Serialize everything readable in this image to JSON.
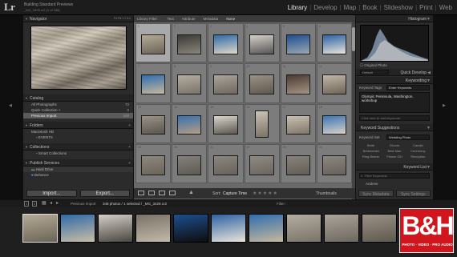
{
  "app": {
    "logo": "Lr",
    "catalog_title": "Building Standard Previews",
    "catalog_sub": "_MG_3405.cr2 (1 of 348)"
  },
  "modules": [
    "Library",
    "Develop",
    "Map",
    "Book",
    "Slideshow",
    "Print",
    "Web"
  ],
  "active_module": "Library",
  "left_panel": {
    "navigator": {
      "label": "Navigator",
      "zoom": "Fit  Fill  1:1  3:1"
    },
    "catalog": {
      "label": "Catalog",
      "items": [
        {
          "label": "All Photographs",
          "count": "70"
        },
        {
          "label": "Quick Collection +",
          "count": "0"
        },
        {
          "label": "Previous Import",
          "count": "348"
        }
      ]
    },
    "folders": {
      "label": "Folders",
      "items": [
        {
          "label": "Macintosh HD",
          "count": ""
        },
        {
          "label": "EVENTS",
          "count": ""
        }
      ]
    },
    "collections": {
      "label": "Collections",
      "items": [
        {
          "label": "Smart Collections"
        }
      ]
    },
    "publish": {
      "label": "Publish Services",
      "items": [
        {
          "label": "Hard Drive"
        },
        {
          "label": "Behance"
        }
      ]
    },
    "import_label": "Import...",
    "export_label": "Export..."
  },
  "grid": {
    "filter_bar": [
      "Library Filter :",
      "Text",
      "Attribute",
      "Metadata",
      "None"
    ],
    "cells": [
      {
        "num": "1",
        "c1": "#b5aa96",
        "c2": "#6b6457",
        "v": false,
        "sel": true
      },
      {
        "num": "2",
        "c1": "#3c3a37",
        "c2": "#8a867c",
        "v": false,
        "sel": false
      },
      {
        "num": "3",
        "c1": "#2f6aa8",
        "c2": "#e0d8c6",
        "v": false,
        "sel": false
      },
      {
        "num": "4",
        "c1": "#d4d0c8",
        "c2": "#555",
        "v": false,
        "sel": false
      },
      {
        "num": "5",
        "c1": "#1d4f8e",
        "c2": "#9aa8b4",
        "v": false,
        "sel": false
      },
      {
        "num": "6",
        "c1": "#2d62a3",
        "c2": "#e8e4da",
        "v": false,
        "sel": false
      },
      {
        "num": "7",
        "c1": "#2f6dae",
        "c2": "#c6b89e",
        "v": false,
        "sel": false
      },
      {
        "num": "8",
        "c1": "#b4aea2",
        "c2": "#7a7468",
        "v": false,
        "sel": false
      },
      {
        "num": "9",
        "c1": "#aaa49a",
        "c2": "#6d675d",
        "v": false,
        "sel": false
      },
      {
        "num": "10",
        "c1": "#9b9286",
        "c2": "#5e584e",
        "v": false,
        "sel": false
      },
      {
        "num": "11",
        "c1": "#4b3a32",
        "c2": "#a39684",
        "v": false,
        "sel": false
      },
      {
        "num": "12",
        "c1": "#c0b7a8",
        "c2": "#6e6558",
        "v": false,
        "sel": false
      },
      {
        "num": "13",
        "c1": "#9a9388",
        "c2": "#5a544a",
        "v": false,
        "sel": false
      },
      {
        "num": "14",
        "c1": "#3870b0",
        "c2": "#b59d83",
        "v": false,
        "sel": false
      },
      {
        "num": "15",
        "c1": "#d9d5cc",
        "c2": "#5b574f",
        "v": false,
        "sel": false
      },
      {
        "num": "16",
        "c1": "#cbc3b4",
        "c2": "#7b7266",
        "v": true,
        "sel": false
      },
      {
        "num": "17",
        "c1": "#c8c0b2",
        "c2": "#807768",
        "v": false,
        "sel": false
      },
      {
        "num": "18",
        "c1": "#3b75b6",
        "c2": "#d8d2c6",
        "v": false,
        "sel": false
      },
      {
        "num": "19",
        "c1": "#8d877c",
        "c2": "#6a645a",
        "v": false,
        "sel": false
      },
      {
        "num": "20",
        "c1": "#85807a",
        "c2": "#5d5953",
        "v": false,
        "sel": false
      },
      {
        "num": "21",
        "c1": "#8a857d",
        "c2": "#67635c",
        "v": false,
        "sel": false
      },
      {
        "num": "22",
        "c1": "#8f8a82",
        "c2": "#6a665f",
        "v": false,
        "sel": false
      },
      {
        "num": "23",
        "c1": "#87827a",
        "c2": "#625e57",
        "v": false,
        "sel": false
      },
      {
        "num": "24",
        "c1": "#8b867e",
        "c2": "#66625b",
        "v": false,
        "sel": false
      }
    ]
  },
  "toolbar": {
    "sort_label": "Sort:",
    "sort_value": "Capture Time",
    "thumbs_label": "Thumbnails"
  },
  "right_panel": {
    "histogram_label": "Histogram",
    "original_photo": "Original Photo",
    "quick_develop": "Quick Develop",
    "saved_preset": "Default",
    "keywording": "Keywording",
    "keyword_tags_label": "Keyword Tags",
    "keyword_tags_value": "Enter Keywords",
    "keywords_text": "Olympic Peninsula, Washington, workshop",
    "click_add": "Click here to add keywords",
    "keyword_suggestions": "Keyword Suggestions",
    "keyword_set_label": "Keyword Set",
    "keyword_set_value": "Wedding Photo",
    "keyword_set_items": [
      "Bride",
      "Groom",
      "Candid",
      "Bridesmaid",
      "Best Man",
      "Ceremony",
      "Ring Bearer",
      "Flower Girl",
      "Reception"
    ],
    "keyword_list": "Keyword List",
    "filter_keywords": "Filter Keywords",
    "keyword_list_item": "Andrew",
    "sync_label": "Sync Metadata",
    "sync_settings": "Sync Settings"
  },
  "filmstrip": {
    "source": "Previous Import",
    "count": "348 photos / 1 selected / _MG_3429.cr2",
    "filter_label": "Filter :",
    "page_nums": [
      "1",
      "2"
    ],
    "frames": [
      {
        "c1": "#b5aa96",
        "c2": "#6b6457"
      },
      {
        "c1": "#2f6aa8",
        "c2": "#c9bda6"
      },
      {
        "c1": "#d4d0c8",
        "c2": "#4a4640"
      },
      {
        "c1": "#7a7266",
        "c2": "#c2b9aa"
      },
      {
        "c1": "#1d4f8e",
        "c2": "#0d0d0d"
      },
      {
        "c1": "#2d62a3",
        "c2": "#e8e4da"
      },
      {
        "c1": "#2f6dae",
        "c2": "#c6b89e"
      },
      {
        "c1": "#b4aea2",
        "c2": "#7a7468"
      },
      {
        "c1": "#aaa49a",
        "c2": "#6d675d"
      },
      {
        "c1": "#9b9286",
        "c2": "#5e584e"
      }
    ]
  },
  "watermark": {
    "brand": "B&H",
    "tag": "PHOTO · VIDEO · PRO AUDIO",
    "color": "#d0161c"
  }
}
